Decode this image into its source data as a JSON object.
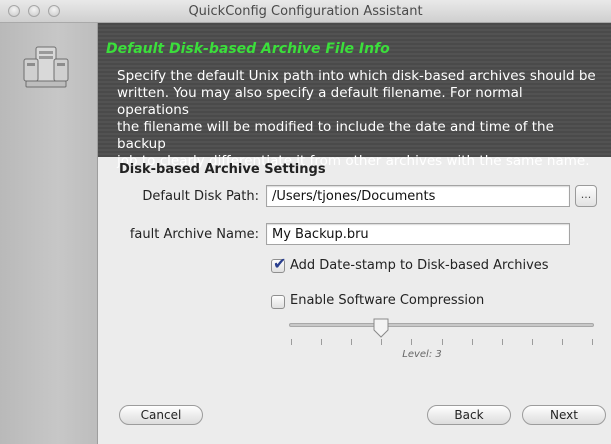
{
  "window": {
    "title": "QuickConfig Configuration Assistant"
  },
  "header": {
    "title": "Default Disk-based Archive File Info",
    "lines": [
      "Specify the default Unix path into which disk-based archives should be",
      "written.  You may also specify a default filename.  For normal operations",
      "the filename will be modified to include the date and time of the backup",
      "job to clearly differentiate it from other archives with the same name."
    ]
  },
  "settings": {
    "section_title": "Disk-based Archive Settings",
    "disk_path_label": "Default Disk Path:",
    "disk_path_value": "/Users/tjones/Documents",
    "browse_label": "...",
    "archive_name_label": "fault Archive Name:",
    "archive_name_value": "My Backup.bru",
    "datestamp_label": "Add Date-stamp to Disk-based Archives",
    "datestamp_checked": true,
    "compression_label": "Enable Software Compression",
    "compression_checked": false,
    "level_label": "Level: 3",
    "level_value": 3,
    "level_fraction": 0.3
  },
  "buttons": {
    "cancel": "Cancel",
    "back": "Back",
    "next": "Next"
  },
  "colors": {
    "header_title": "#3bdf3b",
    "header_bg": "#4a4a4a",
    "checkmark": "#2a3f8e"
  }
}
